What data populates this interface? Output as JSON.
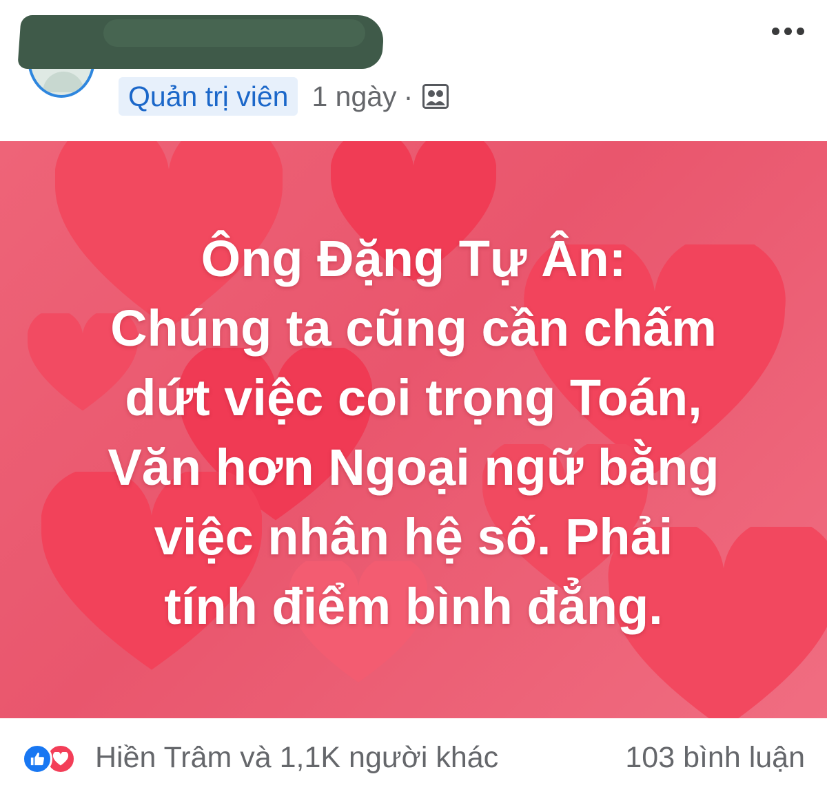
{
  "post": {
    "role_badge": "Quản trị viên",
    "time": "1 ngày",
    "separator": "·",
    "privacy_icon": "group-icon",
    "more_icon": "more-horizontal-icon"
  },
  "image": {
    "lines": [
      "Ông Đặng Tự Ân:",
      "Chúng ta cũng cần chấm",
      "dứt việc coi trọng Toán,",
      "Văn hơn Ngoại ngữ bằng",
      "việc nhân hệ số. Phải",
      "tính điểm bình đẳng."
    ],
    "background_color": "#e9566d"
  },
  "footer": {
    "reactions_text": "Hiền Trâm và 1,1K người khác",
    "comments_text": "103 bình luận",
    "reaction_icons": [
      "like-icon",
      "love-icon"
    ]
  }
}
